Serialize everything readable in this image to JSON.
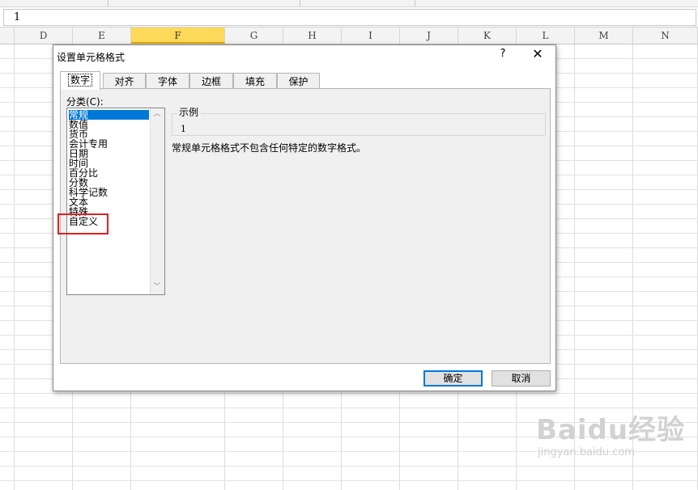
{
  "formula_bar": {
    "value": "1"
  },
  "columns": [
    "D",
    "E",
    "F",
    "G",
    "H",
    "I",
    "J",
    "K",
    "L",
    "M",
    "N"
  ],
  "selected_column": "F",
  "dialog": {
    "title": "设置单元格格式",
    "help_glyph": "?",
    "close_glyph": "✕",
    "tabs": [
      "数字",
      "对齐",
      "字体",
      "边框",
      "填充",
      "保护"
    ],
    "active_tab": "数字",
    "category_label": "分类(C):",
    "categories": [
      "常规",
      "数值",
      "货币",
      "会计专用",
      "日期",
      "时间",
      "百分比",
      "分数",
      "科学记数",
      "文本",
      "特殊",
      "自定义"
    ],
    "selected_category": "常规",
    "highlighted_category": "自定义",
    "sample_label": "示例",
    "sample_value": "1",
    "description": "常规单元格格式不包含任何特定的数字格式。",
    "ok_button": "确定",
    "cancel_button": "取消"
  },
  "watermark": {
    "logo_text": "Baidu经验",
    "url": "jingyan.baidu.com"
  },
  "colors": {
    "selection": "#0078d7",
    "highlight_box": "#e02020",
    "selected_column_header": "#ffd95a"
  }
}
